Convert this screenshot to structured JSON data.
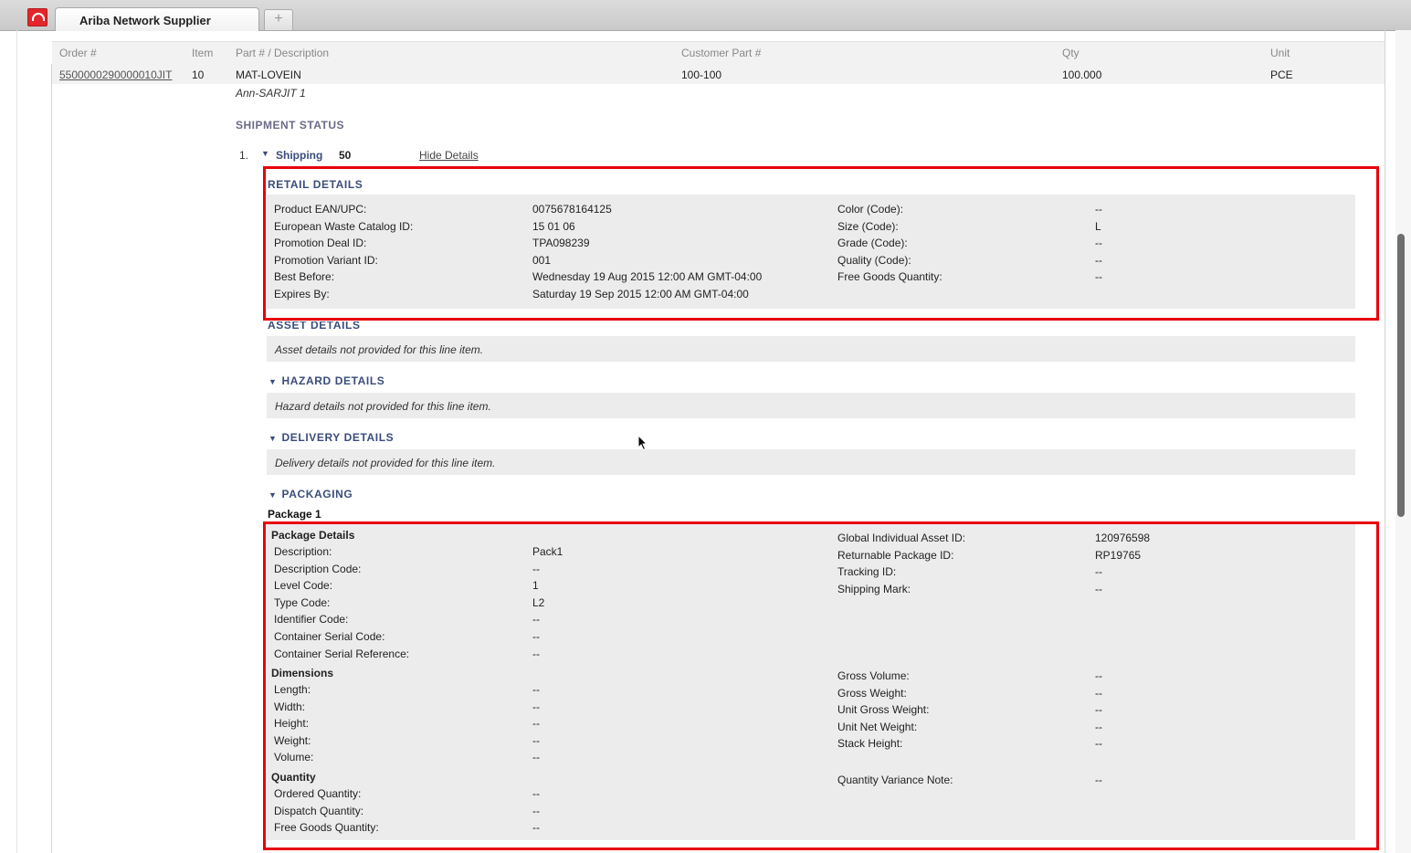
{
  "browser": {
    "tab_title": "Ariba Network Supplier",
    "new_tab_symbol": "+",
    "cutoff_right_text": "......"
  },
  "table": {
    "headers": [
      "Order #",
      "Item",
      "Part # / Description",
      "Customer Part #",
      "Qty",
      "Unit"
    ],
    "row": {
      "order": "5500000290000010JIT",
      "item": "10",
      "part": "MAT-LOVEIN",
      "customer_part": "100-100",
      "qty": "100.000",
      "unit": "PCE",
      "description": "Ann-SARJIT 1"
    }
  },
  "shipment": {
    "status_title": "SHIPMENT STATUS",
    "line_number": "1.",
    "label": "Shipping",
    "quantity": "50",
    "hide_details": "Hide Details"
  },
  "retail": {
    "title": "RETAIL DETAILS",
    "left": [
      {
        "label": "Product EAN/UPC:",
        "value": "0075678164125"
      },
      {
        "label": "European Waste Catalog ID:",
        "value": "15 01 06"
      },
      {
        "label": "Promotion Deal ID:",
        "value": "TPA098239"
      },
      {
        "label": "Promotion Variant ID:",
        "value": "001"
      },
      {
        "label": "Best Before:",
        "value": "Wednesday 19 Aug 2015 12:00 AM GMT-04:00"
      },
      {
        "label": "Expires By:",
        "value": "Saturday 19 Sep 2015 12:00 AM GMT-04:00"
      }
    ],
    "right": [
      {
        "label": "Color (Code):",
        "value": "--"
      },
      {
        "label": "Size (Code):",
        "value": "L"
      },
      {
        "label": "Grade (Code):",
        "value": "--"
      },
      {
        "label": "Quality (Code):",
        "value": "--"
      },
      {
        "label": "Free Goods Quantity:",
        "value": "--"
      }
    ]
  },
  "asset": {
    "title": "ASSET DETAILS",
    "message": "Asset details not provided for this line item."
  },
  "hazard": {
    "title": "HAZARD DETAILS",
    "message": "Hazard details not provided for this line item."
  },
  "delivery": {
    "title": "DELIVERY DETAILS",
    "message": "Delivery details not provided for this line item."
  },
  "packaging": {
    "title": "PACKAGING",
    "package_label": "Package 1",
    "details_heading": "Package Details",
    "details_left": [
      {
        "label": "Description:",
        "value": "Pack1"
      },
      {
        "label": "Description Code:",
        "value": "--"
      },
      {
        "label": "Level Code:",
        "value": "1"
      },
      {
        "label": "Type Code:",
        "value": "L2"
      },
      {
        "label": "Identifier Code:",
        "value": "--"
      },
      {
        "label": "Container Serial Code:",
        "value": "--"
      },
      {
        "label": "Container Serial Reference:",
        "value": "--"
      }
    ],
    "details_right": [
      {
        "label": "Global Individual Asset ID:",
        "value": "120976598"
      },
      {
        "label": "Returnable Package ID:",
        "value": "RP19765"
      },
      {
        "label": "Tracking ID:",
        "value": "--"
      },
      {
        "label": "Shipping Mark:",
        "value": "--"
      }
    ],
    "dimensions_heading": "Dimensions",
    "dimensions_left": [
      {
        "label": "Length:",
        "value": "--"
      },
      {
        "label": "Width:",
        "value": "--"
      },
      {
        "label": "Height:",
        "value": "--"
      },
      {
        "label": "Weight:",
        "value": "--"
      },
      {
        "label": "Volume:",
        "value": "--"
      }
    ],
    "dimensions_right": [
      {
        "label": "Gross Volume:",
        "value": "--"
      },
      {
        "label": "Gross Weight:",
        "value": "--"
      },
      {
        "label": "Unit Gross Weight:",
        "value": "--"
      },
      {
        "label": "Unit Net Weight:",
        "value": "--"
      },
      {
        "label": "Stack Height:",
        "value": "--"
      }
    ],
    "quantity_heading": "Quantity",
    "quantity_left": [
      {
        "label": "Ordered Quantity:",
        "value": "--"
      },
      {
        "label": "Dispatch Quantity:",
        "value": "--"
      },
      {
        "label": "Free Goods Quantity:",
        "value": "--"
      }
    ],
    "quantity_right": [
      {
        "label": "Quantity Variance Note:",
        "value": "--"
      }
    ]
  },
  "colors": {
    "highlight": "#e8000b",
    "section_title": "#3a4d7a",
    "panel_bg": "#ececec"
  }
}
